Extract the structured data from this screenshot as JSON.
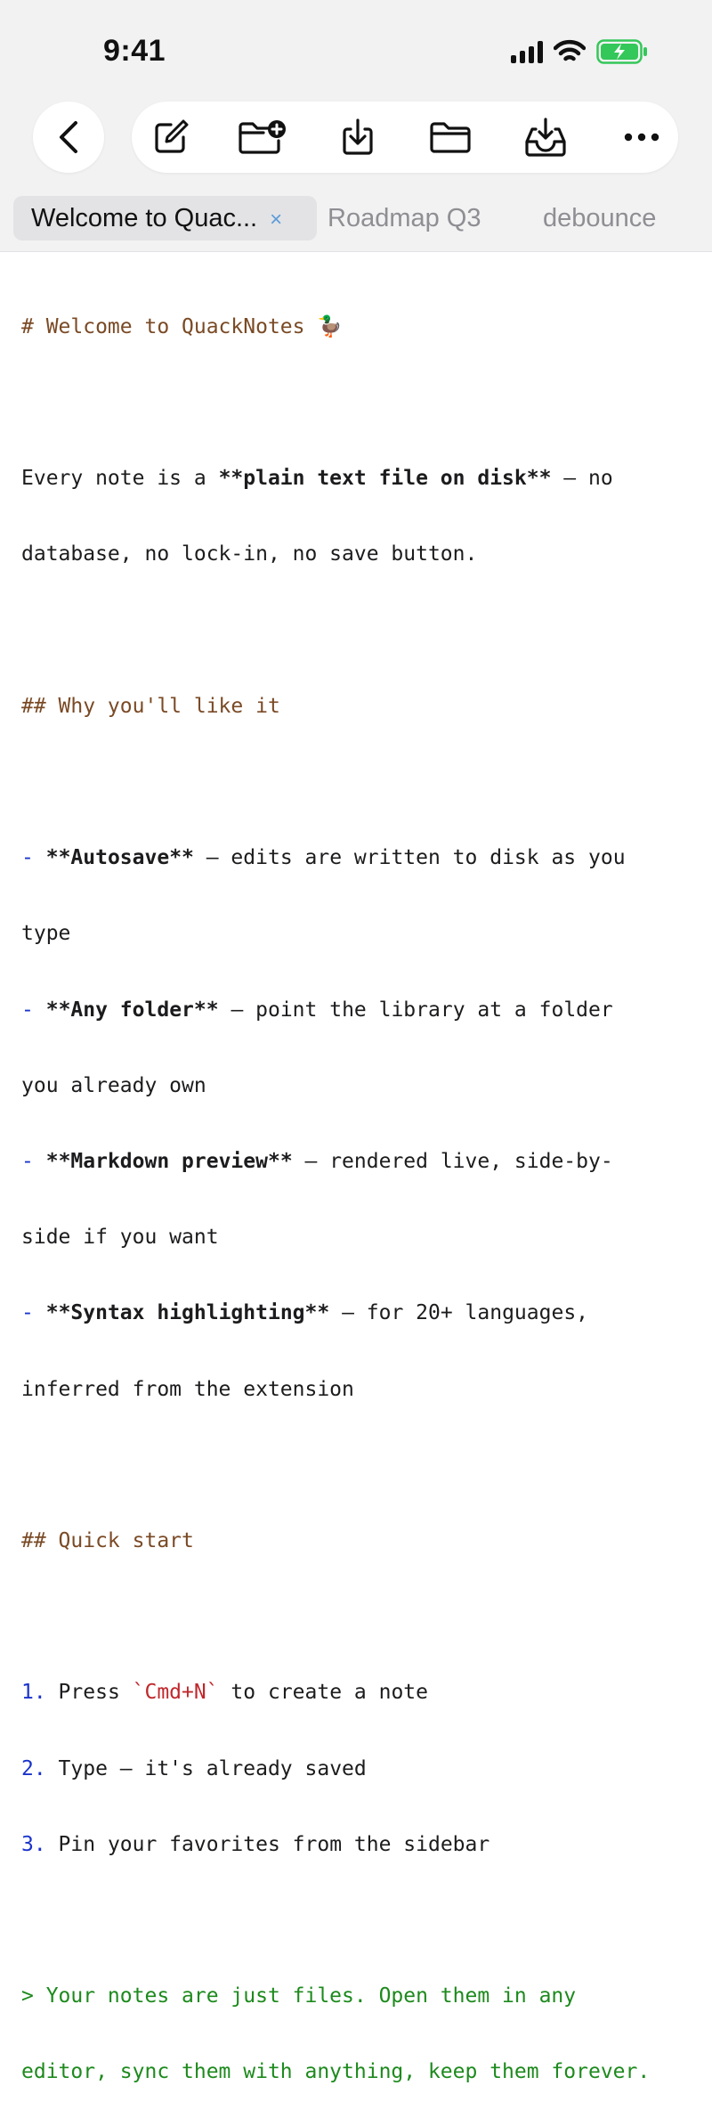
{
  "status_bar": {
    "time": "9:41"
  },
  "toolbar": {
    "back_icon": "chevron-left-icon",
    "icons": [
      "compose-icon",
      "new-folder-icon",
      "download-icon",
      "folder-icon",
      "inbox-download-icon",
      "more-icon"
    ]
  },
  "tabs": [
    {
      "label": "Welcome to Quac...",
      "close": "×",
      "active": true
    },
    {
      "label": "Roadmap Q3",
      "active": false
    },
    {
      "label": "debounce",
      "active": false
    }
  ],
  "editor": {
    "h1": "# Welcome to QuackNotes 🦆",
    "intro": {
      "text_a": "Every note is a ",
      "bold": "**plain text file on disk**",
      "text_b": " — no",
      "line2": "database, no lock-in, no save button."
    },
    "h2_why": "## Why you'll like it",
    "features": [
      {
        "dash": "-",
        "bold": "**Autosave**",
        "rest": " — edits are written to disk as you",
        "cont": "type"
      },
      {
        "dash": "-",
        "bold": "**Any folder**",
        "rest": " — point the library at a folder",
        "cont": "you already own"
      },
      {
        "dash": "-",
        "bold": "**Markdown preview**",
        "rest": " — rendered live, side-by-",
        "cont": "side if you want"
      },
      {
        "dash": "-",
        "bold": "**Syntax highlighting**",
        "rest": " — for 20+ languages,",
        "cont": "inferred from the extension"
      }
    ],
    "h2_quick": "## Quick start",
    "steps": [
      {
        "num": "1.",
        "text_a": " Press ",
        "code": "`Cmd+N`",
        "text_b": " to create a note"
      },
      {
        "num": "2.",
        "text_a": " Type — it's already saved"
      },
      {
        "num": "3.",
        "text_a": " Pin your favorites from the sidebar"
      }
    ],
    "quote_line1": "> Your notes are just files. Open them in any",
    "quote_line2": "editor, sync them with anything, keep them forever."
  },
  "colors": {
    "heading": "#7a4a25",
    "bullet": "#1a33cc",
    "code": "#c0282c",
    "quote": "#1d8a1d",
    "battery": "#34c759",
    "tab_close": "#5b9bd9"
  }
}
